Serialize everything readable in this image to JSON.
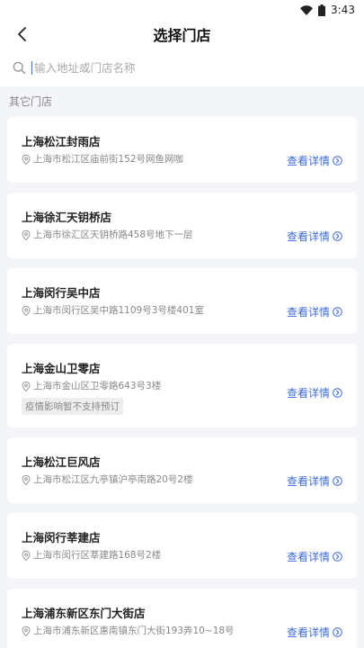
{
  "status_bar": {
    "time": "3:43",
    "icons": [
      "wifi-icon",
      "battery-icon"
    ]
  },
  "header": {
    "title": "选择门店",
    "back_icon": "chevron-left-icon"
  },
  "search": {
    "placeholder": "输入地址或门店名称",
    "icon": "search-icon"
  },
  "section_label": "其它门店",
  "colors": {
    "accent": "#3d6bd6",
    "background": "#f4f5f8"
  },
  "stores": [
    {
      "name": "上海松江封雨店",
      "address": "上海市松江区庙前街152号网鱼网咖",
      "detail_label": "查看详情"
    },
    {
      "name": "上海徐汇天钥桥店",
      "address": "上海市徐汇区天钥桥路458号地下一层",
      "detail_label": "查看详情"
    },
    {
      "name": "上海闵行吴中店",
      "address": "上海市闵行区吴中路1109号3号楼401室",
      "detail_label": "查看详情"
    },
    {
      "name": "上海金山卫零店",
      "address": "上海市金山区卫零路643号3楼",
      "detail_label": "查看详情",
      "tag": "疫情影响暂不支持预订"
    },
    {
      "name": "上海松江巨风店",
      "address": "上海市松江区九亭镇沪亭南路20号2楼",
      "detail_label": "查看详情"
    },
    {
      "name": "上海闵行莘建店",
      "address": "上海市闵行区莘建路168号2楼",
      "detail_label": "查看详情"
    },
    {
      "name": "上海浦东新区东门大街店",
      "address": "上海市浦东新区惠南镇东门大街193弄10~18号",
      "detail_label": "查看详情"
    }
  ]
}
